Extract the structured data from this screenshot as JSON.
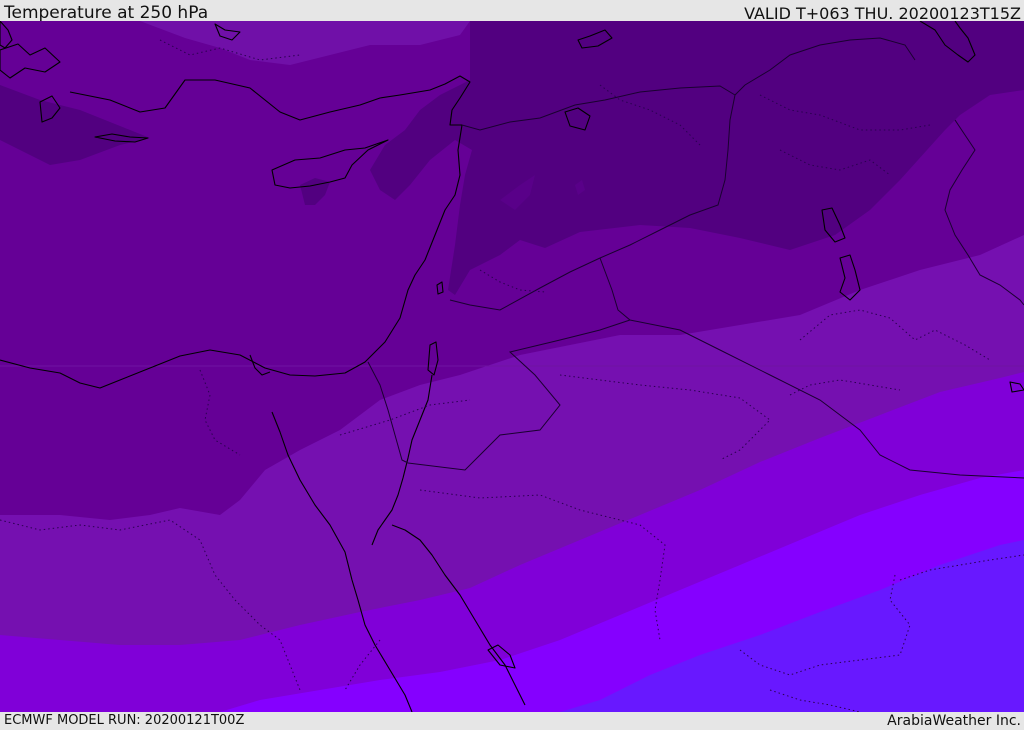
{
  "header": {
    "title": "Temperature at 250 hPa",
    "valid": "VALID T+063 THU. 20200123T15Z"
  },
  "footer": {
    "model_run": "ECMWF MODEL RUN: 20200121T00Z",
    "credit": "ArabiaWeather Inc."
  },
  "map": {
    "variable": "temperature",
    "level": "250 hPa",
    "colors": {
      "band_darkest": "#520080",
      "band_dark": "#650096",
      "band_mid": "#7510b0",
      "band_bright": "#8000d8",
      "band_violet": "#8500ff",
      "band_blue_violet": "#6818ff",
      "coastline": "#000000",
      "border": "#1a0030"
    },
    "overlays": [
      "coastlines",
      "country-borders",
      "internal-boundaries"
    ]
  }
}
